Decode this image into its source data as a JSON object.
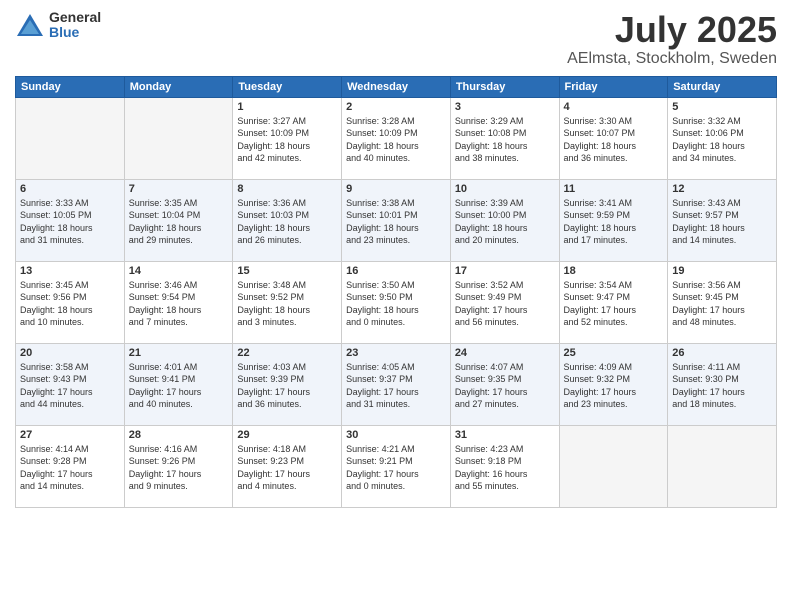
{
  "header": {
    "logo_general": "General",
    "logo_blue": "Blue",
    "title": "July 2025",
    "location": "AElmsta, Stockholm, Sweden"
  },
  "weekdays": [
    "Sunday",
    "Monday",
    "Tuesday",
    "Wednesday",
    "Thursday",
    "Friday",
    "Saturday"
  ],
  "weeks": [
    [
      {
        "day": "",
        "info": ""
      },
      {
        "day": "",
        "info": ""
      },
      {
        "day": "1",
        "info": "Sunrise: 3:27 AM\nSunset: 10:09 PM\nDaylight: 18 hours\nand 42 minutes."
      },
      {
        "day": "2",
        "info": "Sunrise: 3:28 AM\nSunset: 10:09 PM\nDaylight: 18 hours\nand 40 minutes."
      },
      {
        "day": "3",
        "info": "Sunrise: 3:29 AM\nSunset: 10:08 PM\nDaylight: 18 hours\nand 38 minutes."
      },
      {
        "day": "4",
        "info": "Sunrise: 3:30 AM\nSunset: 10:07 PM\nDaylight: 18 hours\nand 36 minutes."
      },
      {
        "day": "5",
        "info": "Sunrise: 3:32 AM\nSunset: 10:06 PM\nDaylight: 18 hours\nand 34 minutes."
      }
    ],
    [
      {
        "day": "6",
        "info": "Sunrise: 3:33 AM\nSunset: 10:05 PM\nDaylight: 18 hours\nand 31 minutes."
      },
      {
        "day": "7",
        "info": "Sunrise: 3:35 AM\nSunset: 10:04 PM\nDaylight: 18 hours\nand 29 minutes."
      },
      {
        "day": "8",
        "info": "Sunrise: 3:36 AM\nSunset: 10:03 PM\nDaylight: 18 hours\nand 26 minutes."
      },
      {
        "day": "9",
        "info": "Sunrise: 3:38 AM\nSunset: 10:01 PM\nDaylight: 18 hours\nand 23 minutes."
      },
      {
        "day": "10",
        "info": "Sunrise: 3:39 AM\nSunset: 10:00 PM\nDaylight: 18 hours\nand 20 minutes."
      },
      {
        "day": "11",
        "info": "Sunrise: 3:41 AM\nSunset: 9:59 PM\nDaylight: 18 hours\nand 17 minutes."
      },
      {
        "day": "12",
        "info": "Sunrise: 3:43 AM\nSunset: 9:57 PM\nDaylight: 18 hours\nand 14 minutes."
      }
    ],
    [
      {
        "day": "13",
        "info": "Sunrise: 3:45 AM\nSunset: 9:56 PM\nDaylight: 18 hours\nand 10 minutes."
      },
      {
        "day": "14",
        "info": "Sunrise: 3:46 AM\nSunset: 9:54 PM\nDaylight: 18 hours\nand 7 minutes."
      },
      {
        "day": "15",
        "info": "Sunrise: 3:48 AM\nSunset: 9:52 PM\nDaylight: 18 hours\nand 3 minutes."
      },
      {
        "day": "16",
        "info": "Sunrise: 3:50 AM\nSunset: 9:50 PM\nDaylight: 18 hours\nand 0 minutes."
      },
      {
        "day": "17",
        "info": "Sunrise: 3:52 AM\nSunset: 9:49 PM\nDaylight: 17 hours\nand 56 minutes."
      },
      {
        "day": "18",
        "info": "Sunrise: 3:54 AM\nSunset: 9:47 PM\nDaylight: 17 hours\nand 52 minutes."
      },
      {
        "day": "19",
        "info": "Sunrise: 3:56 AM\nSunset: 9:45 PM\nDaylight: 17 hours\nand 48 minutes."
      }
    ],
    [
      {
        "day": "20",
        "info": "Sunrise: 3:58 AM\nSunset: 9:43 PM\nDaylight: 17 hours\nand 44 minutes."
      },
      {
        "day": "21",
        "info": "Sunrise: 4:01 AM\nSunset: 9:41 PM\nDaylight: 17 hours\nand 40 minutes."
      },
      {
        "day": "22",
        "info": "Sunrise: 4:03 AM\nSunset: 9:39 PM\nDaylight: 17 hours\nand 36 minutes."
      },
      {
        "day": "23",
        "info": "Sunrise: 4:05 AM\nSunset: 9:37 PM\nDaylight: 17 hours\nand 31 minutes."
      },
      {
        "day": "24",
        "info": "Sunrise: 4:07 AM\nSunset: 9:35 PM\nDaylight: 17 hours\nand 27 minutes."
      },
      {
        "day": "25",
        "info": "Sunrise: 4:09 AM\nSunset: 9:32 PM\nDaylight: 17 hours\nand 23 minutes."
      },
      {
        "day": "26",
        "info": "Sunrise: 4:11 AM\nSunset: 9:30 PM\nDaylight: 17 hours\nand 18 minutes."
      }
    ],
    [
      {
        "day": "27",
        "info": "Sunrise: 4:14 AM\nSunset: 9:28 PM\nDaylight: 17 hours\nand 14 minutes."
      },
      {
        "day": "28",
        "info": "Sunrise: 4:16 AM\nSunset: 9:26 PM\nDaylight: 17 hours\nand 9 minutes."
      },
      {
        "day": "29",
        "info": "Sunrise: 4:18 AM\nSunset: 9:23 PM\nDaylight: 17 hours\nand 4 minutes."
      },
      {
        "day": "30",
        "info": "Sunrise: 4:21 AM\nSunset: 9:21 PM\nDaylight: 17 hours\nand 0 minutes."
      },
      {
        "day": "31",
        "info": "Sunrise: 4:23 AM\nSunset: 9:18 PM\nDaylight: 16 hours\nand 55 minutes."
      },
      {
        "day": "",
        "info": ""
      },
      {
        "day": "",
        "info": ""
      }
    ]
  ]
}
